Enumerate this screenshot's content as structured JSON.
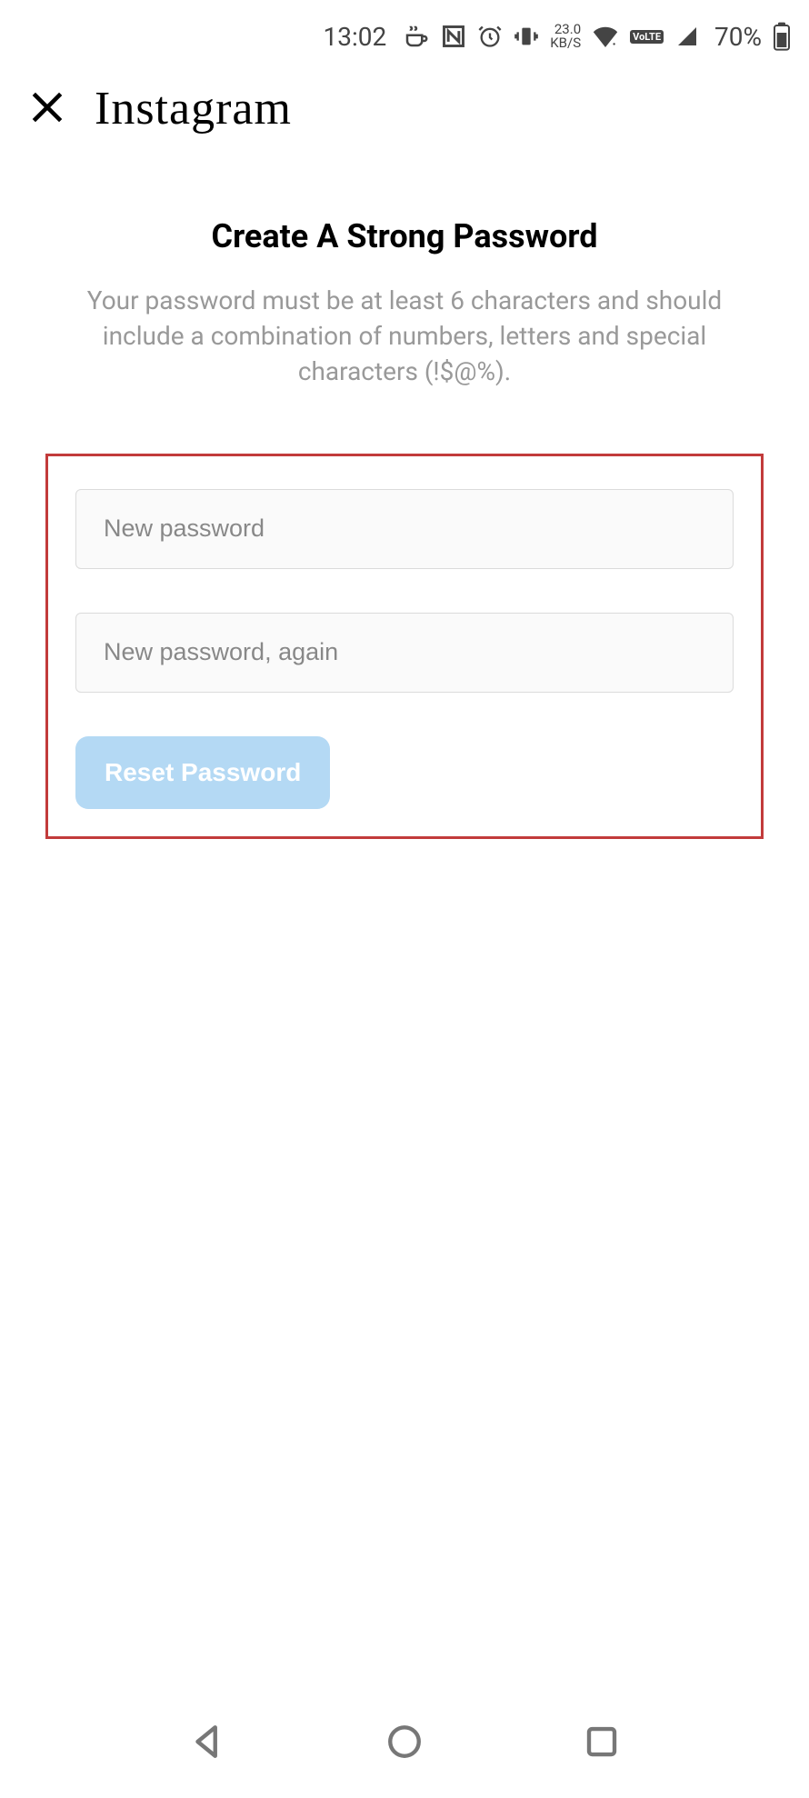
{
  "status_bar": {
    "time": "13:02",
    "data_rate_value": "23.0",
    "data_rate_unit": "KB/S",
    "volte_label": "VoLTE",
    "battery_percent": "70%"
  },
  "header": {
    "app_name": "Instagram"
  },
  "main": {
    "title": "Create A Strong Password",
    "subtitle": "Your password must be at least 6 characters and should include a combination of numbers, letters and special characters (!$@%)."
  },
  "form": {
    "new_password_placeholder": "New password",
    "new_password_value": "",
    "confirm_password_placeholder": "New password, again",
    "confirm_password_value": "",
    "submit_label": "Reset Password"
  },
  "colors": {
    "highlight_border": "#c23b3b",
    "button_bg": "#b4d9f4"
  }
}
